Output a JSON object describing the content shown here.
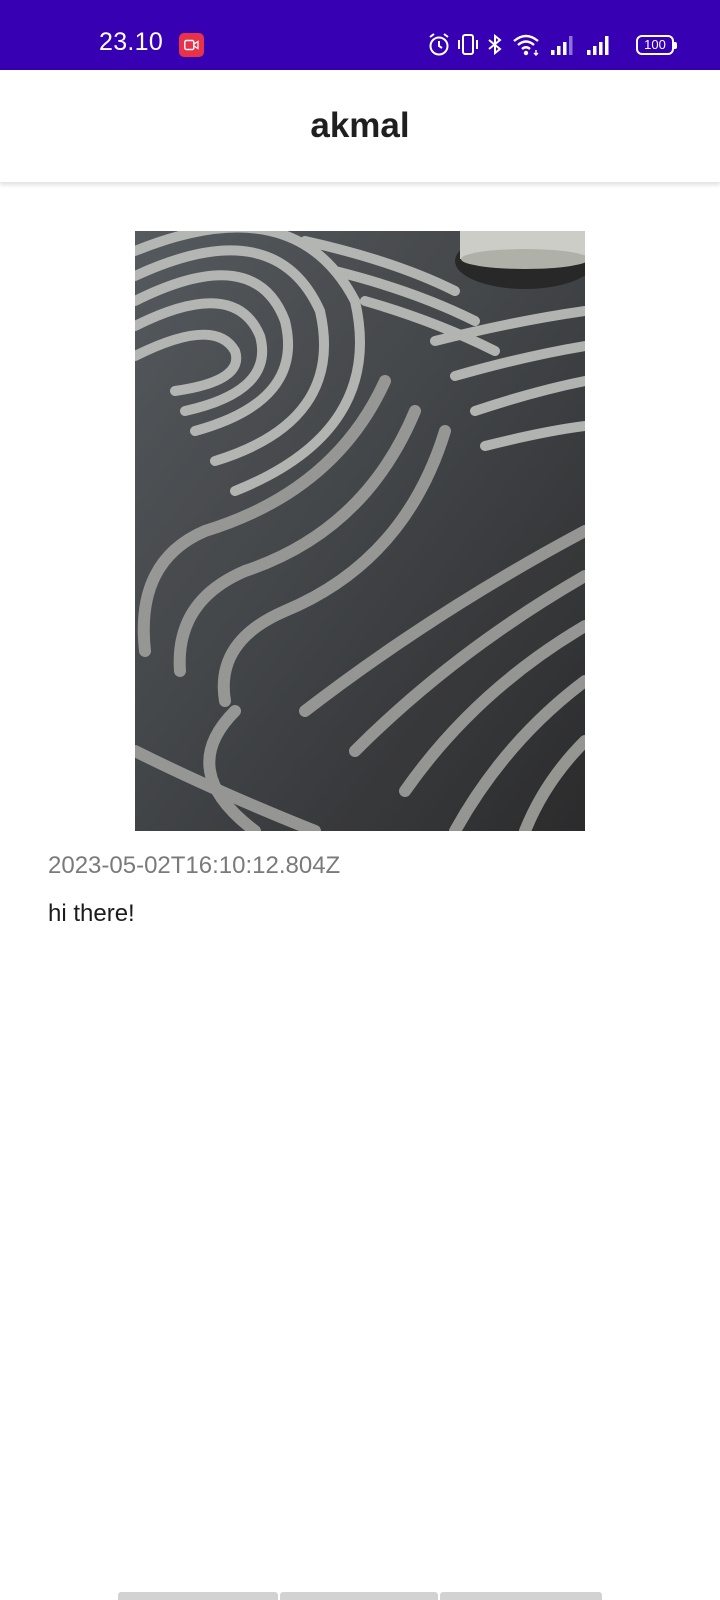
{
  "status_bar": {
    "time": "23.10",
    "battery_level": "100",
    "background_color": "#3700b3",
    "icons": [
      "screen-record-icon",
      "alarm-icon",
      "vibrate-icon",
      "bluetooth-icon",
      "wifi-icon",
      "signal-sim1-icon",
      "signal-sim2-icon",
      "battery-icon"
    ]
  },
  "app_bar": {
    "title": "akmal"
  },
  "post": {
    "image_alt": "photo",
    "timestamp": "2023-05-02T16:10:12.804Z",
    "caption": "hi there!"
  }
}
